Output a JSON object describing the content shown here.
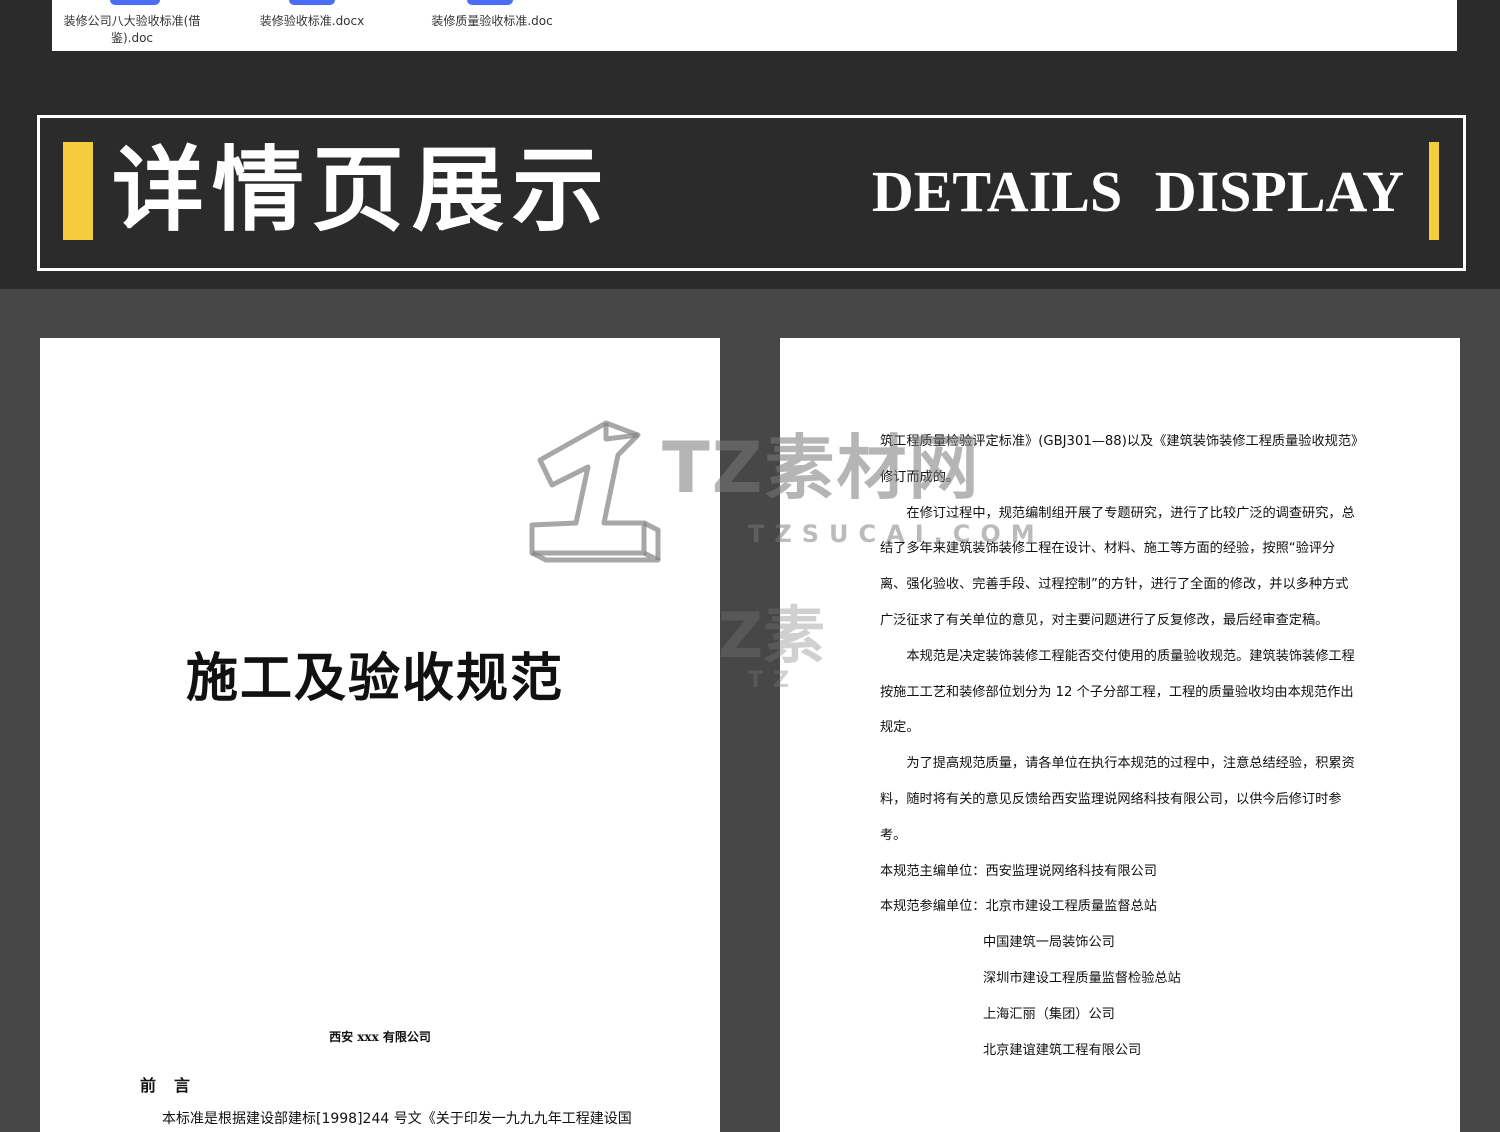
{
  "files": [
    {
      "label": "装修公司八大验收标准(借\n鉴).doc"
    },
    {
      "label": "装修验收标准.docx"
    },
    {
      "label": "装修质量验收标准.doc"
    }
  ],
  "banner": {
    "title_cn": "详情页展示",
    "title_en": "DETAILS DISPLAY"
  },
  "watermark": {
    "brand": "TZ素材网",
    "domain": "TZSUCAI.COM",
    "ghost": "Z素",
    "ghost_domain": "TZ"
  },
  "left_page": {
    "title": "施工及验收规范",
    "company": "西安 xxx 有限公司",
    "preface_heading": "前言",
    "body_start": "本标准是根据建设部建标[1998]244 号文《关于印发一九九九年工程建设国"
  },
  "right_page": {
    "paragraphs": [
      "筑工程质量检验评定标准》(GBJ301—88)以及《建筑装饰装修工程质量验收规范》修订而成的。",
      "在修订过程中，规范编制组开展了专题研究，进行了比较广泛的调查研究，总结了多年来建筑装饰装修工程在设计、材料、施工等方面的经验，按照“验评分离、强化验收、完善手段、过程控制”的方针，进行了全面的修改，并以多种方式广泛征求了有关单位的意见，对主要问题进行了反复修改，最后经审查定稿。",
      "本规范是决定装饰装修工程能否交付使用的质量验收规范。建筑装饰装修工程按施工工艺和装修部位划分为 12 个子分部工程，工程的质量验收均由本规范作出规定。",
      "为了提高规范质量，请各单位在执行本规范的过程中，注意总结经验，积累资料，随时将有关的意见反馈给西安监理说网络科技有限公司，以供今后修订时参考。"
    ],
    "chief_unit": "本规范主编单位：西安监理说网络科技有限公司",
    "participating_label": "本规范参编单位：北京市建设工程质量监督总站",
    "participating_units": [
      "中国建筑一局装饰公司",
      "深圳市建设工程质量监督检验总站",
      "上海汇丽（集团）公司",
      "北京建谊建筑工程有限公司"
    ]
  },
  "colors": {
    "accent_yellow": "#f5cc3e",
    "dark_bg": "#2b2b2b",
    "mid_bg": "#474747"
  }
}
